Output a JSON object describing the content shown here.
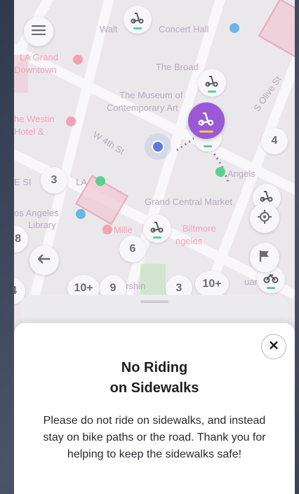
{
  "map": {
    "labels": {
      "walt": "Walt",
      "concert": "Concert Hall",
      "la_grand": "LA Grand",
      "downtown": "Downtown",
      "broad": "The Broad",
      "museum1": "The Museum of",
      "museum2": "Contemporary Art",
      "olive": "S Olive St",
      "westin1": "he Westin",
      "westin2": "Hotel &",
      "w4th": "W 4th St",
      "angels": "Angels",
      "esi": "E SI",
      "la": "LA",
      "gcm": "Grand Central Market",
      "la_lib1": "os Angeles",
      "la_lib2": "Library",
      "mille": "Mille",
      "biltmore1": "Biltmore",
      "biltmore2": "ngeles",
      "pershing": "ershin",
      "square": "uare"
    },
    "clusters": {
      "c3a": "3",
      "c4": "4",
      "c8": "8",
      "c6": "6",
      "c4b": "4",
      "c10a": "10+",
      "c9": "9",
      "c3b": "3",
      "c10b": "10+"
    }
  },
  "modal": {
    "title_line1": "No Riding",
    "title_line2": "on Sidewalks",
    "body": "Please do not ride on sidewalks, and instead stay on bike paths or the road.  Thank you for helping to keep the sidewalks safe!"
  },
  "colors": {
    "accent": "#9b59d6",
    "vehicle_bar": "#5ccf8f"
  }
}
